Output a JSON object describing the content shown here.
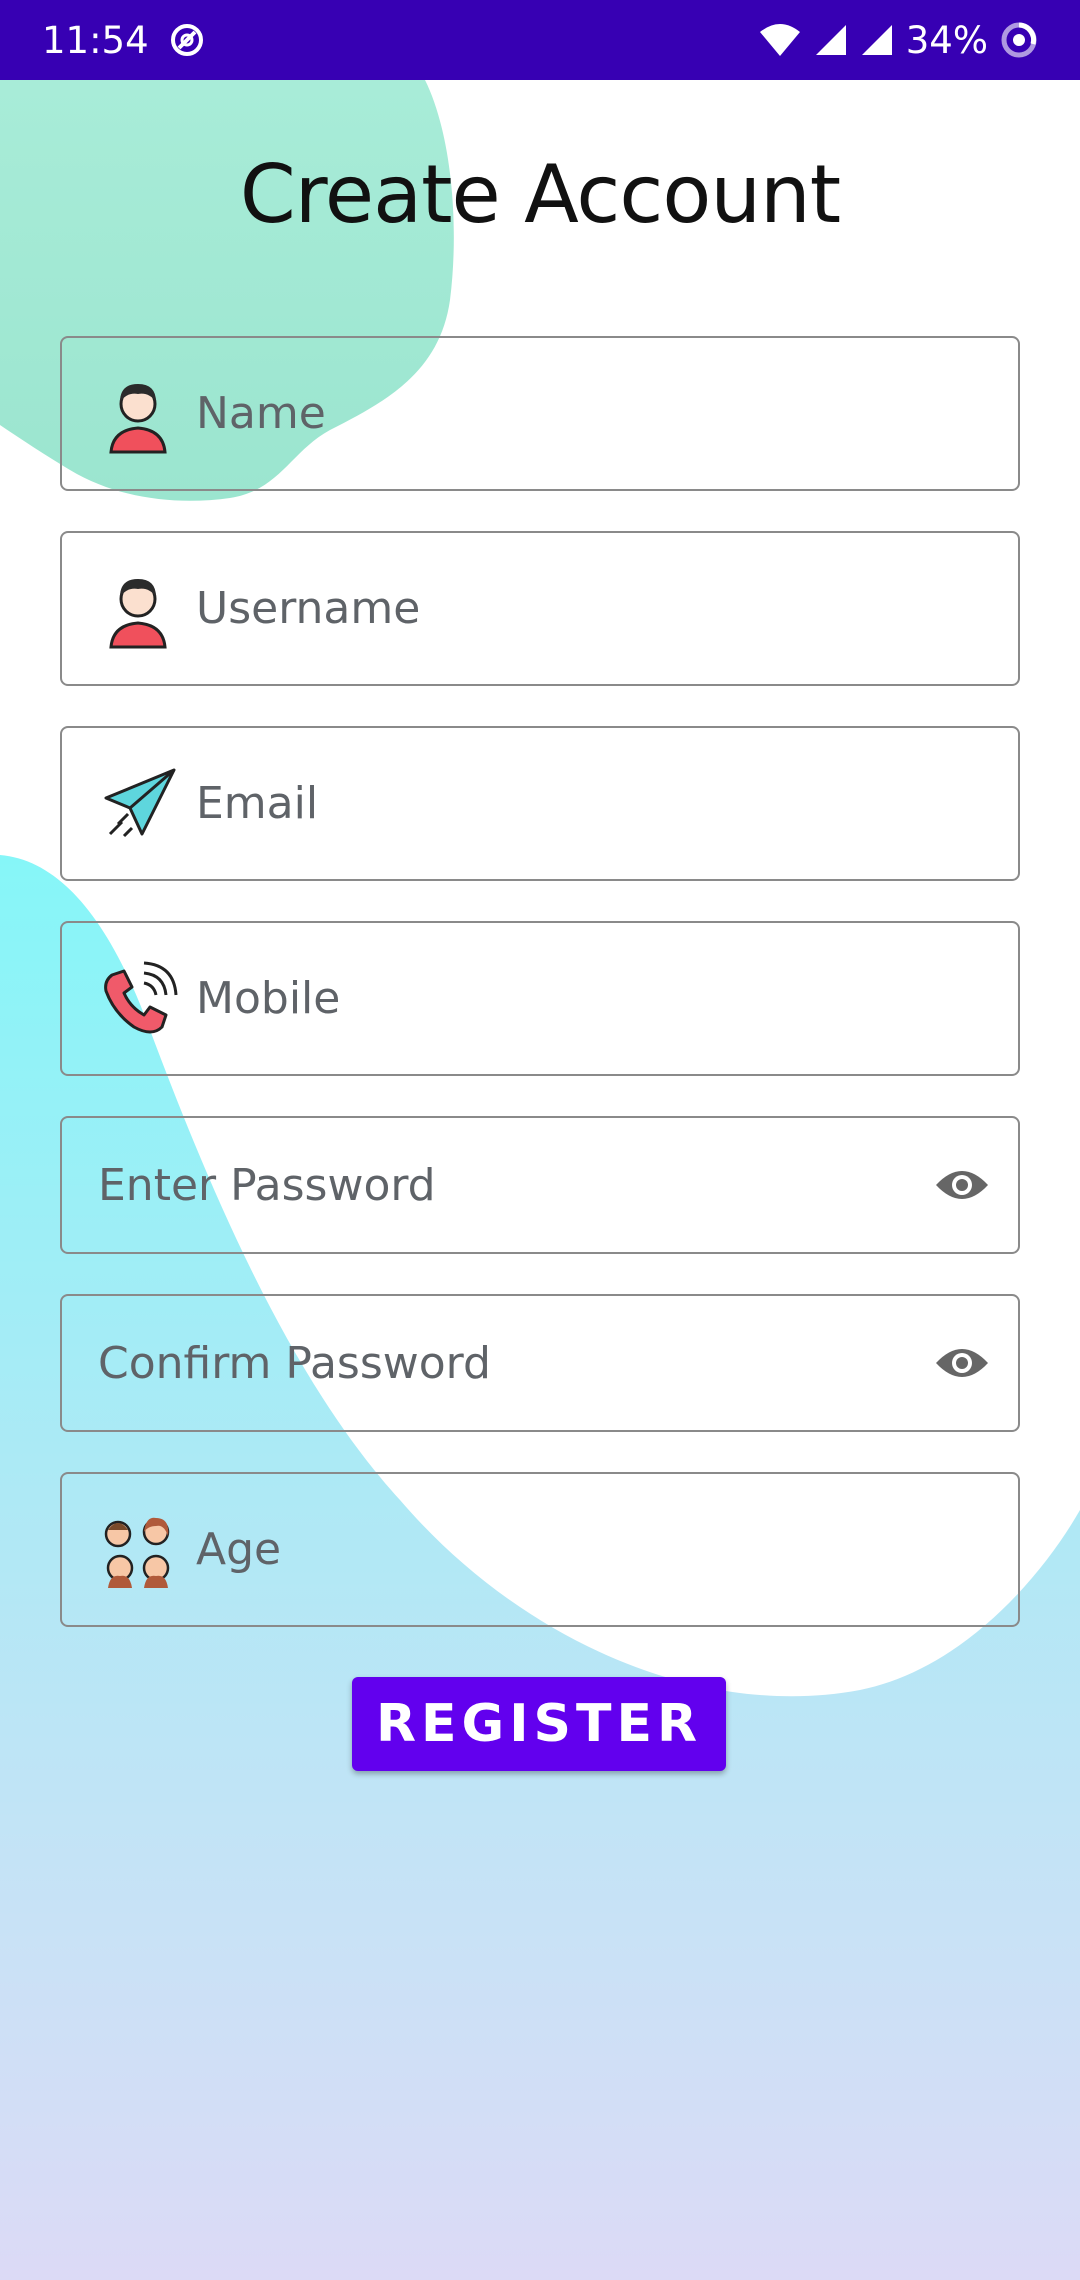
{
  "status_bar": {
    "time": "11:54",
    "battery": "34%",
    "icons": [
      "at-icon",
      "wifi-icon",
      "signal-icon",
      "signal-icon",
      "battery-ring-icon"
    ]
  },
  "colors": {
    "status_bar": "#3700b3",
    "button": "#6200ee",
    "green_blob": "#a6ead5",
    "cyan_top": "#86f6f8",
    "lavender_bottom": "#dcdaf6"
  },
  "page": {
    "title": "Create Account"
  },
  "form": {
    "name": {
      "placeholder": "Name",
      "icon": "person-icon"
    },
    "username": {
      "placeholder": "Username",
      "icon": "person-icon"
    },
    "email": {
      "placeholder": "Email",
      "icon": "paper-plane-icon"
    },
    "mobile": {
      "placeholder": "Mobile",
      "icon": "phone-icon"
    },
    "password": {
      "placeholder": "Enter Password",
      "icon": "eye-icon"
    },
    "confirm_password": {
      "placeholder": "Confirm Password",
      "icon": "eye-icon"
    },
    "age": {
      "placeholder": "Age",
      "icon": "family-icon"
    }
  },
  "register_label": "REGISTER"
}
